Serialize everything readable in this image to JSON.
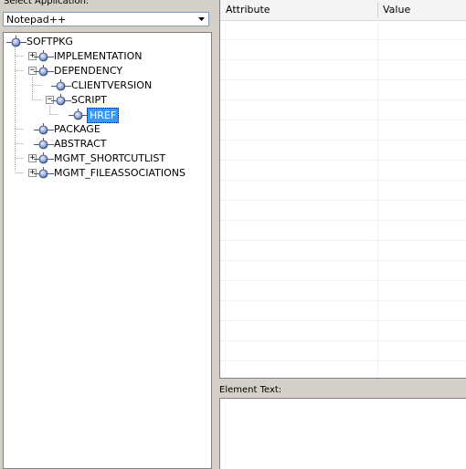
{
  "app_selector": {
    "label": "Select Application:",
    "selected": "Notepad++"
  },
  "tree": {
    "nodes": [
      {
        "label": "SOFTPKG",
        "expander": "none",
        "selected": false
      },
      {
        "label": "IMPLEMENTATION",
        "expander": "+",
        "selected": false
      },
      {
        "label": "DEPENDENCY",
        "expander": "-",
        "selected": false
      },
      {
        "label": "CLIENTVERSION",
        "expander": "none",
        "selected": false
      },
      {
        "label": "SCRIPT",
        "expander": "-",
        "selected": false
      },
      {
        "label": "HREF",
        "expander": "none",
        "selected": true
      },
      {
        "label": "PACKAGE",
        "expander": "none",
        "selected": false
      },
      {
        "label": "ABSTRACT",
        "expander": "none",
        "selected": false
      },
      {
        "label": "MGMT_SHORTCUTLIST",
        "expander": "+",
        "selected": false
      },
      {
        "label": "MGMT_FILEASSOCIATIONS",
        "expander": "+",
        "selected": false
      }
    ]
  },
  "grid": {
    "columns": [
      "Attribute",
      "Value"
    ]
  },
  "element_text": {
    "label": "Element Text:",
    "value": ""
  },
  "colors": {
    "selection": "#3399ff",
    "window_bg": "#d4d0c8"
  },
  "icons": {
    "node": "xml-node-icon",
    "combo_arrow": "chevron-down-icon"
  }
}
